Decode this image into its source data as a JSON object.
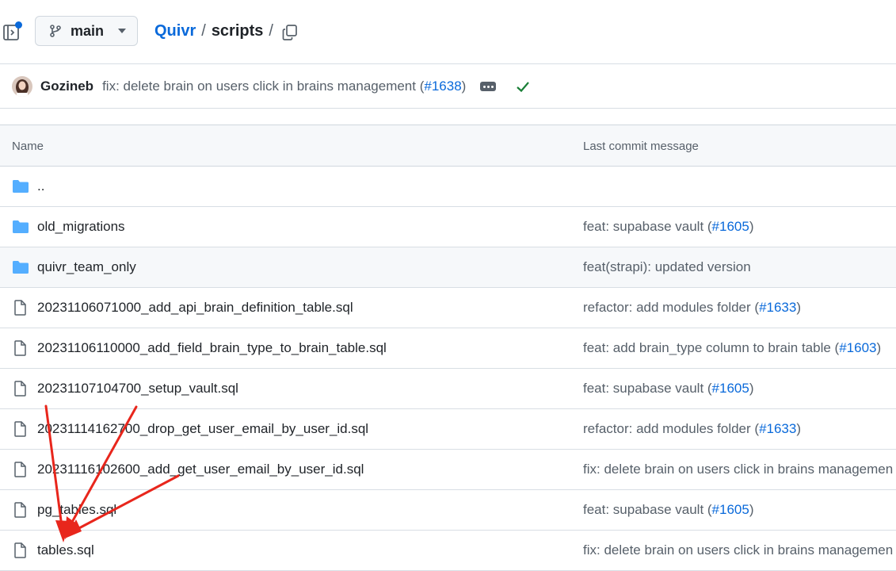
{
  "header": {
    "branch": "main",
    "repo": "Quivr",
    "sep1": "/",
    "dir": "scripts",
    "sep2": "/"
  },
  "commit": {
    "author": "Gozineb",
    "message": "fix: delete brain on users click in brains management (",
    "pr": "#1638",
    "close": ")"
  },
  "table": {
    "headers": {
      "name": "Name",
      "message": "Last commit message"
    },
    "rows": [
      {
        "type": "folder",
        "name": "..",
        "msg": "",
        "pr": "",
        "close": ""
      },
      {
        "type": "folder",
        "name": "old_migrations",
        "msg": "feat: supabase vault (",
        "pr": "#1605",
        "close": ")"
      },
      {
        "type": "folder",
        "name": "quivr_team_only",
        "msg": "feat(strapi): updated version",
        "pr": "",
        "close": ""
      },
      {
        "type": "file",
        "name": "20231106071000_add_api_brain_definition_table.sql",
        "msg": "refactor: add modules folder (",
        "pr": "#1633",
        "close": ")"
      },
      {
        "type": "file",
        "name": "20231106110000_add_field_brain_type_to_brain_table.sql",
        "msg": "feat: add brain_type column to brain table (",
        "pr": "#1603",
        "close": ")"
      },
      {
        "type": "file",
        "name": "20231107104700_setup_vault.sql",
        "msg": "feat: supabase vault (",
        "pr": "#1605",
        "close": ")"
      },
      {
        "type": "file",
        "name": "20231114162700_drop_get_user_email_by_user_id.sql",
        "msg": "refactor: add modules folder (",
        "pr": "#1633",
        "close": ")"
      },
      {
        "type": "file",
        "name": "20231116102600_add_get_user_email_by_user_id.sql",
        "msg": "fix: delete brain on users click in brains managemen",
        "pr": "",
        "close": ""
      },
      {
        "type": "file",
        "name": "pg_tables.sql",
        "msg": "feat: supabase vault (",
        "pr": "#1605",
        "close": ")"
      },
      {
        "type": "file",
        "name": "tables.sql",
        "msg": "fix: delete brain on users click in brains managemen",
        "pr": "",
        "close": ""
      }
    ]
  },
  "colors": {
    "accent": "#0969da",
    "folder": "#54aeff",
    "success": "#1a7f37",
    "annotation": "#e8261c"
  },
  "icons": [
    "sidebar-toggle-icon",
    "branch-icon",
    "copy-icon",
    "ellipsis-icon",
    "check-icon",
    "folder-icon",
    "file-icon"
  ]
}
